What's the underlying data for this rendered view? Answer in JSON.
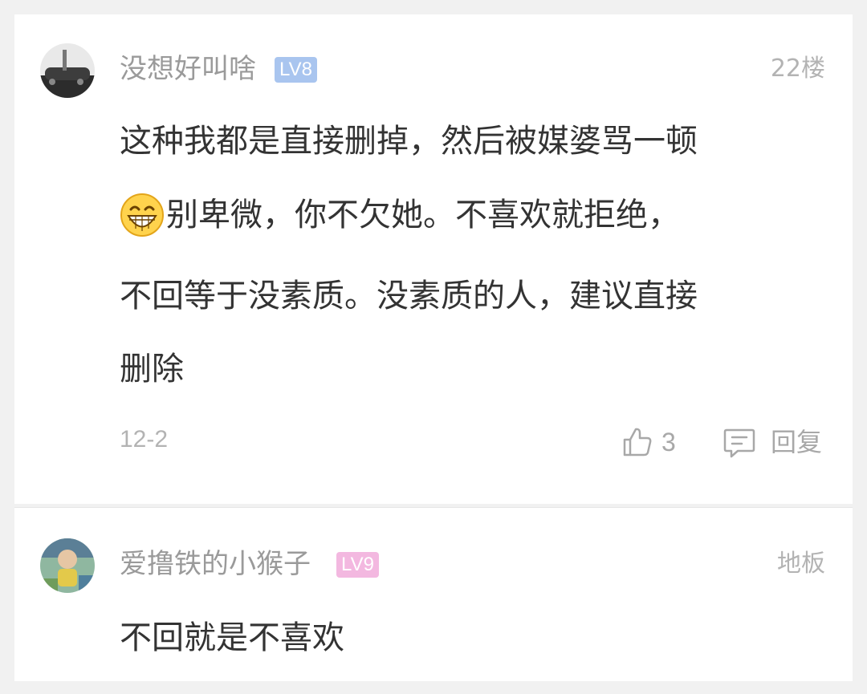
{
  "comments": [
    {
      "username": "没想好叫啥",
      "level": "LV8",
      "level_color": "#a9c5ef",
      "floor": "22楼",
      "lines": [
        "这种我都是直接删掉，然后被媒婆骂一顿",
        "别卑微，你不欠她。不喜欢就拒绝，",
        "不回等于没素质。没素质的人，建议直接",
        "删除"
      ],
      "emoji": "grinning-face-icon",
      "date": "12-2",
      "likes": "3",
      "reply_label": "回复"
    },
    {
      "username": "爱撸铁的小猴子",
      "level": "LV9",
      "level_color": "#f3b8e0",
      "floor": "地板",
      "lines": [
        "不回就是不喜欢"
      ]
    }
  ]
}
